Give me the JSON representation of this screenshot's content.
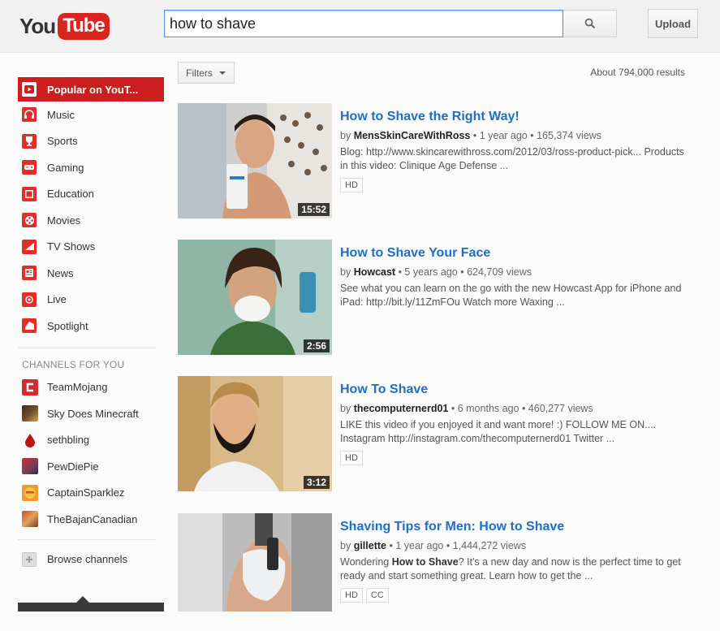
{
  "header": {
    "logo_you": "You",
    "logo_tube": "Tube",
    "search_value": "how to shave",
    "upload_label": "Upload"
  },
  "sidebar": {
    "items": [
      {
        "label": "Popular on YouT...",
        "icon": "youtube-icon",
        "active": true
      },
      {
        "label": "Music",
        "icon": "headphones-icon"
      },
      {
        "label": "Sports",
        "icon": "trophy-icon"
      },
      {
        "label": "Gaming",
        "icon": "gamepad-icon"
      },
      {
        "label": "Education",
        "icon": "education-icon"
      },
      {
        "label": "Movies",
        "icon": "film-reel-icon"
      },
      {
        "label": "TV Shows",
        "icon": "tv-icon"
      },
      {
        "label": "News",
        "icon": "newspaper-icon"
      },
      {
        "label": "Live",
        "icon": "live-icon"
      },
      {
        "label": "Spotlight",
        "icon": "spotlight-icon"
      }
    ],
    "channels_heading": "CHANNELS FOR YOU",
    "channels": [
      {
        "label": "TeamMojang"
      },
      {
        "label": "Sky Does Minecraft"
      },
      {
        "label": "sethbling"
      },
      {
        "label": "PewDiePie"
      },
      {
        "label": "CaptainSparklez"
      },
      {
        "label": "TheBajanCanadian"
      }
    ],
    "browse_label": "Browse channels"
  },
  "main": {
    "filters_label": "Filters",
    "results_count": "About 794,000 results",
    "results": [
      {
        "title": "How to Shave the Right Way!",
        "by": "by",
        "author": "MensSkinCareWithRoss",
        "meta": "• 1 year ago • 165,374 views",
        "desc_line1": "Blog: http://www.skincarewithross.com/2012/03/ross-product-pick... Products",
        "desc_line2": "in this video: Clinique Age Defense ...",
        "duration": "15:52",
        "badges": [
          "HD"
        ]
      },
      {
        "title": "How to Shave Your Face",
        "by": "by",
        "author": "Howcast",
        "meta": "• 5 years ago • 624,709 views",
        "desc_line1": "See what you can learn on the go with the new Howcast App for iPhone and",
        "desc_line2": "iPad: http://bit.ly/11ZmFOu Watch more Waxing ...",
        "duration": "2:56",
        "badges": []
      },
      {
        "title": "How To Shave",
        "by": "by",
        "author": "thecomputernerd01",
        "meta": "• 6 months ago • 460,277 views",
        "desc_line1": "LIKE this video if you enjoyed it and want more! :) FOLLOW ME ON....",
        "desc_line2": "Instagram http://instagram.com/thecomputernerd01 Twitter ...",
        "duration": "3:12",
        "badges": [
          "HD"
        ]
      },
      {
        "title": "Shaving Tips for Men: How to Shave",
        "by": "by",
        "author": "gillette",
        "meta": "• 1 year ago • 1,444,272 views",
        "desc_pre": "Wondering ",
        "desc_bold": "How to Shave",
        "desc_post": "? It's a new day and now is the perfect time to get",
        "desc_line2": "ready and start something great. Learn how to get the ...",
        "duration": "",
        "badges": [
          "HD",
          "CC"
        ]
      }
    ]
  },
  "colors": {
    "accent_red": "#cc1e1e",
    "link_blue": "#1b6fc9"
  }
}
